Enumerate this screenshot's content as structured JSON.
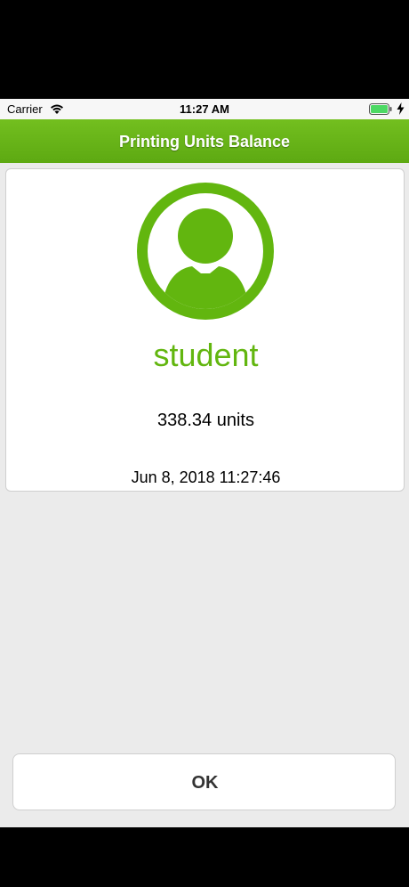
{
  "status_bar": {
    "carrier": "Carrier",
    "time": "11:27 AM",
    "battery_level": 1.0
  },
  "nav_bar": {
    "title": "Printing Units Balance"
  },
  "profile": {
    "username": "student",
    "balance": "338.34 units",
    "timestamp": "Jun 8, 2018 11:27:46"
  },
  "actions": {
    "ok_label": "OK"
  },
  "colors": {
    "accent_green": "#62b60f",
    "nav_green": "#6bb71a",
    "background": "#ebebeb"
  },
  "icons": {
    "avatar": "user-avatar-icon",
    "wifi": "wifi-icon",
    "battery": "battery-icon",
    "charging": "charging-bolt-icon"
  }
}
